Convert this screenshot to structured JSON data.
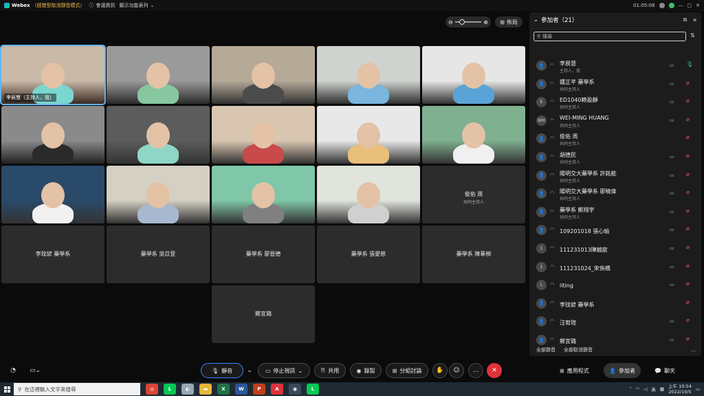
{
  "titlebar": {
    "brand": "Webex",
    "mode": "（經營型取消靜音模式）",
    "meeting_info": "會議資訊",
    "view_menu": "顯示功能表列",
    "time": "01:05:08"
  },
  "stage": {
    "layout_label": "佈局",
    "tiles": [
      {
        "label": "李辰慧（主持人，我）",
        "video": true,
        "active": true
      },
      {
        "label": "",
        "video": true
      },
      {
        "label": "",
        "video": true
      },
      {
        "label": "",
        "video": true
      },
      {
        "label": "",
        "video": true
      },
      {
        "label": "",
        "video": true
      },
      {
        "label": "",
        "video": true
      },
      {
        "label": "",
        "video": true
      },
      {
        "label": "",
        "video": true
      },
      {
        "label": "",
        "video": true
      },
      {
        "label": "",
        "video": true
      },
      {
        "label": "",
        "video": true
      },
      {
        "label": "",
        "video": true
      },
      {
        "label": "",
        "video": true
      },
      {
        "label": "俊佑 周",
        "role": "共同主持人",
        "video": false
      },
      {
        "label": "李玟諺 藥學系",
        "video": false
      },
      {
        "label": "藥學系 吳苡萱",
        "video": false
      },
      {
        "label": "藥學系 廖晉德",
        "video": false
      },
      {
        "label": "藥學系 張愛慈",
        "video": false
      },
      {
        "label": "藥學系 陳葦栁",
        "video": false
      },
      {
        "label": "鄭宜璐",
        "video": false
      }
    ]
  },
  "panel": {
    "title": "參加者（21）",
    "search_placeholder": "搜尋",
    "mute_all": "全部靜音",
    "unmute_all": "全部取消靜音",
    "participants": [
      {
        "avatar": "",
        "name": "李辰慧",
        "role": "主持人，我",
        "mic": "on",
        "cam": true
      },
      {
        "avatar": "",
        "name": "鍾芷芊 藥學系",
        "role": "共同主持人",
        "mic": "off",
        "cam": true
      },
      {
        "avatar": "E",
        "name": "ED1040賴盈靜",
        "role": "共同主持人",
        "mic": "off",
        "cam": true
      },
      {
        "avatar": "WH",
        "name": "WEI-MING HUANG",
        "role": "共同主持人",
        "mic": "off",
        "cam": true
      },
      {
        "avatar": "",
        "name": "俊佑 周",
        "role": "共同主持人",
        "mic": "off",
        "cam": false
      },
      {
        "avatar": "",
        "name": "胡德民",
        "role": "共同主持人",
        "mic": "off",
        "cam": true
      },
      {
        "avatar": "",
        "name": "陽明交大藥學系 許銘能",
        "role": "共同主持人",
        "mic": "off",
        "cam": true
      },
      {
        "avatar": "",
        "name": "陽明交大藥學系 廖曉偉",
        "role": "共同主持人",
        "mic": "off",
        "cam": true
      },
      {
        "avatar": "",
        "name": "藥學系 鄭翔宇",
        "role": "共同主持人",
        "mic": "off",
        "cam": true
      },
      {
        "avatar": "",
        "name": "109201018 張心瑜",
        "role": "",
        "mic": "off",
        "cam": true
      },
      {
        "avatar": "1",
        "name": "111231013陳毓歆",
        "role": "",
        "mic": "off",
        "cam": true
      },
      {
        "avatar": "1",
        "name": "111231024_宋侑橋",
        "role": "",
        "mic": "off",
        "cam": true
      },
      {
        "avatar": "L",
        "name": "liting",
        "role": "",
        "mic": "off",
        "cam": true
      },
      {
        "avatar": "",
        "name": "李玟諺 藥學系",
        "role": "",
        "mic": "off",
        "cam": false
      },
      {
        "avatar": "",
        "name": "汪宥瑄",
        "role": "",
        "mic": "off",
        "cam": true
      },
      {
        "avatar": "",
        "name": "鄭宜璐",
        "role": "",
        "mic": "off",
        "cam": true
      }
    ]
  },
  "toolbar": {
    "mute": "靜音",
    "stop_video": "停止視訊",
    "share": "共用",
    "record": "錄製",
    "breakout": "分組討論",
    "apps": "應用程式",
    "participants": "參加者",
    "chat": "聊天"
  },
  "taskbar": {
    "search_placeholder": "在這裡輸入文字來搜尋",
    "ime": "英",
    "time": "上午 10:54",
    "date": "2022/10/5"
  },
  "colors": {
    "accent": "#3f82ff",
    "leave": "#e0323a",
    "mic_on": "#39c26b",
    "mic_off": "#e45a5a"
  }
}
